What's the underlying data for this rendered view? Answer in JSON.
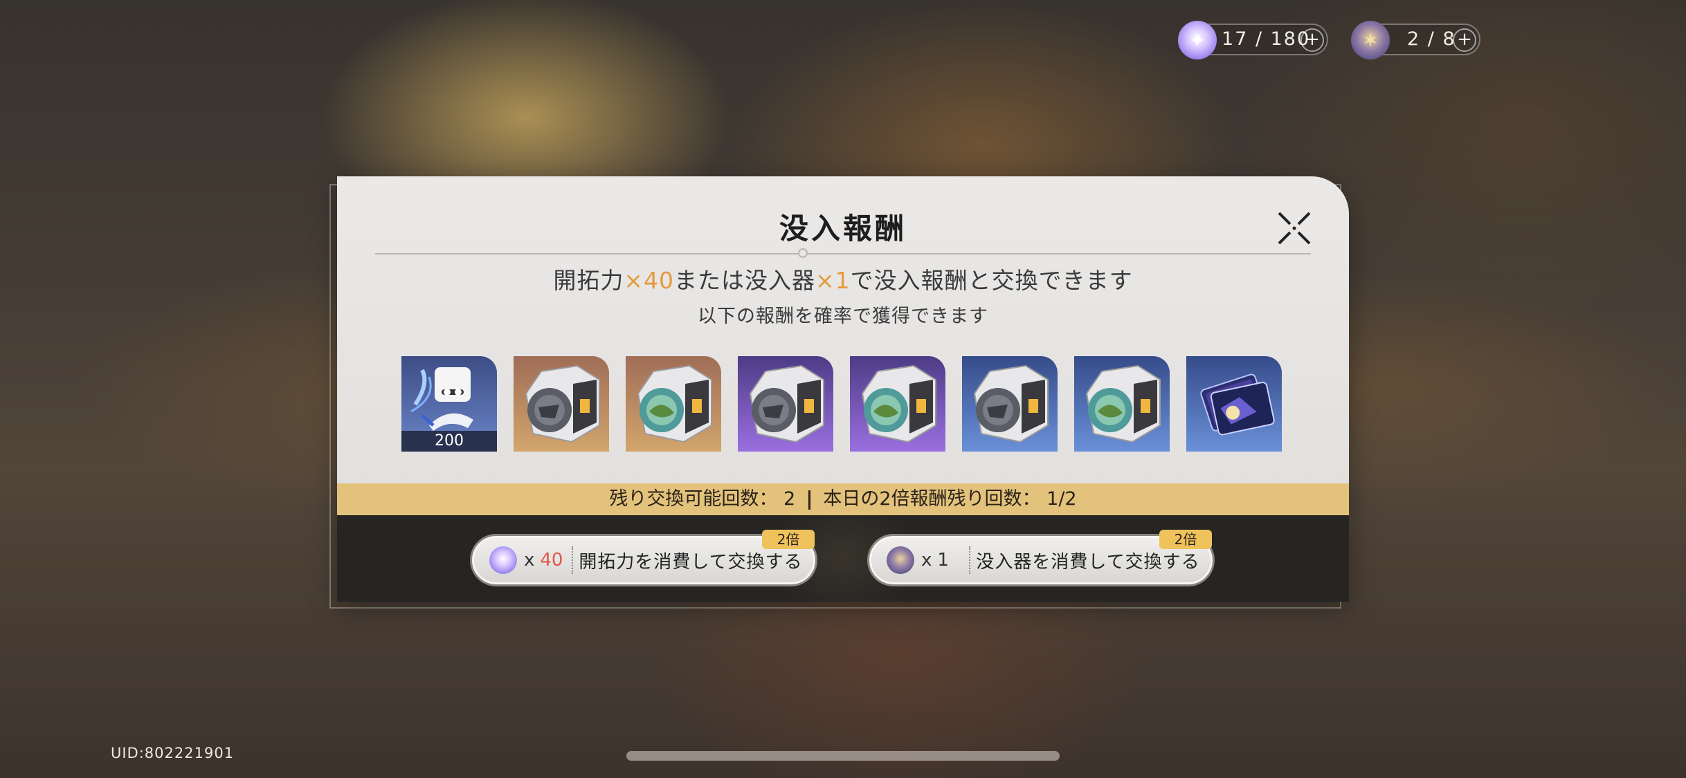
{
  "resources": {
    "trailblaze_power": {
      "value": "17 / 180",
      "icon": "trailblaze-power-icon"
    },
    "immersifier": {
      "value": "2 / 8",
      "icon": "immersifier-icon"
    }
  },
  "modal": {
    "title": "没入報酬",
    "desc_line1": {
      "p1": "開拓力",
      "mult1": "×40",
      "p2": "または没入器",
      "mult2": "×1",
      "p3": "で没入報酬と交換できます"
    },
    "desc_line2": "以下の報酬を確率で獲得できます",
    "rewards": [
      {
        "icon": "ticket-character-icon",
        "count": "200"
      },
      {
        "icon": "relic-dark-orb-icon"
      },
      {
        "icon": "relic-green-orb-icon"
      },
      {
        "icon": "relic-dark-orb-icon"
      },
      {
        "icon": "relic-green-orb-icon"
      },
      {
        "icon": "relic-dark-orb-icon"
      },
      {
        "icon": "relic-green-orb-icon"
      },
      {
        "icon": "card-pass-icon"
      }
    ],
    "counts": {
      "remaining_label": "残り交換可能回数：",
      "remaining_value": "2",
      "double_label": "本日の2倍報酬残り回数：",
      "double_value": "1/2"
    },
    "buttons": {
      "power": {
        "x": "x",
        "amount": "40",
        "label": "開拓力を消費して交換する",
        "badge": "2倍"
      },
      "device": {
        "x": "x",
        "amount": "1",
        "label": "没入器を消費して交換する",
        "badge": "2倍"
      }
    }
  },
  "uid": "UID:802221901",
  "colors": {
    "highlight": "#e59a3c",
    "count_bar": "#e3c27c",
    "badge": "#f0c25b",
    "amount_red": "#e0584d"
  }
}
